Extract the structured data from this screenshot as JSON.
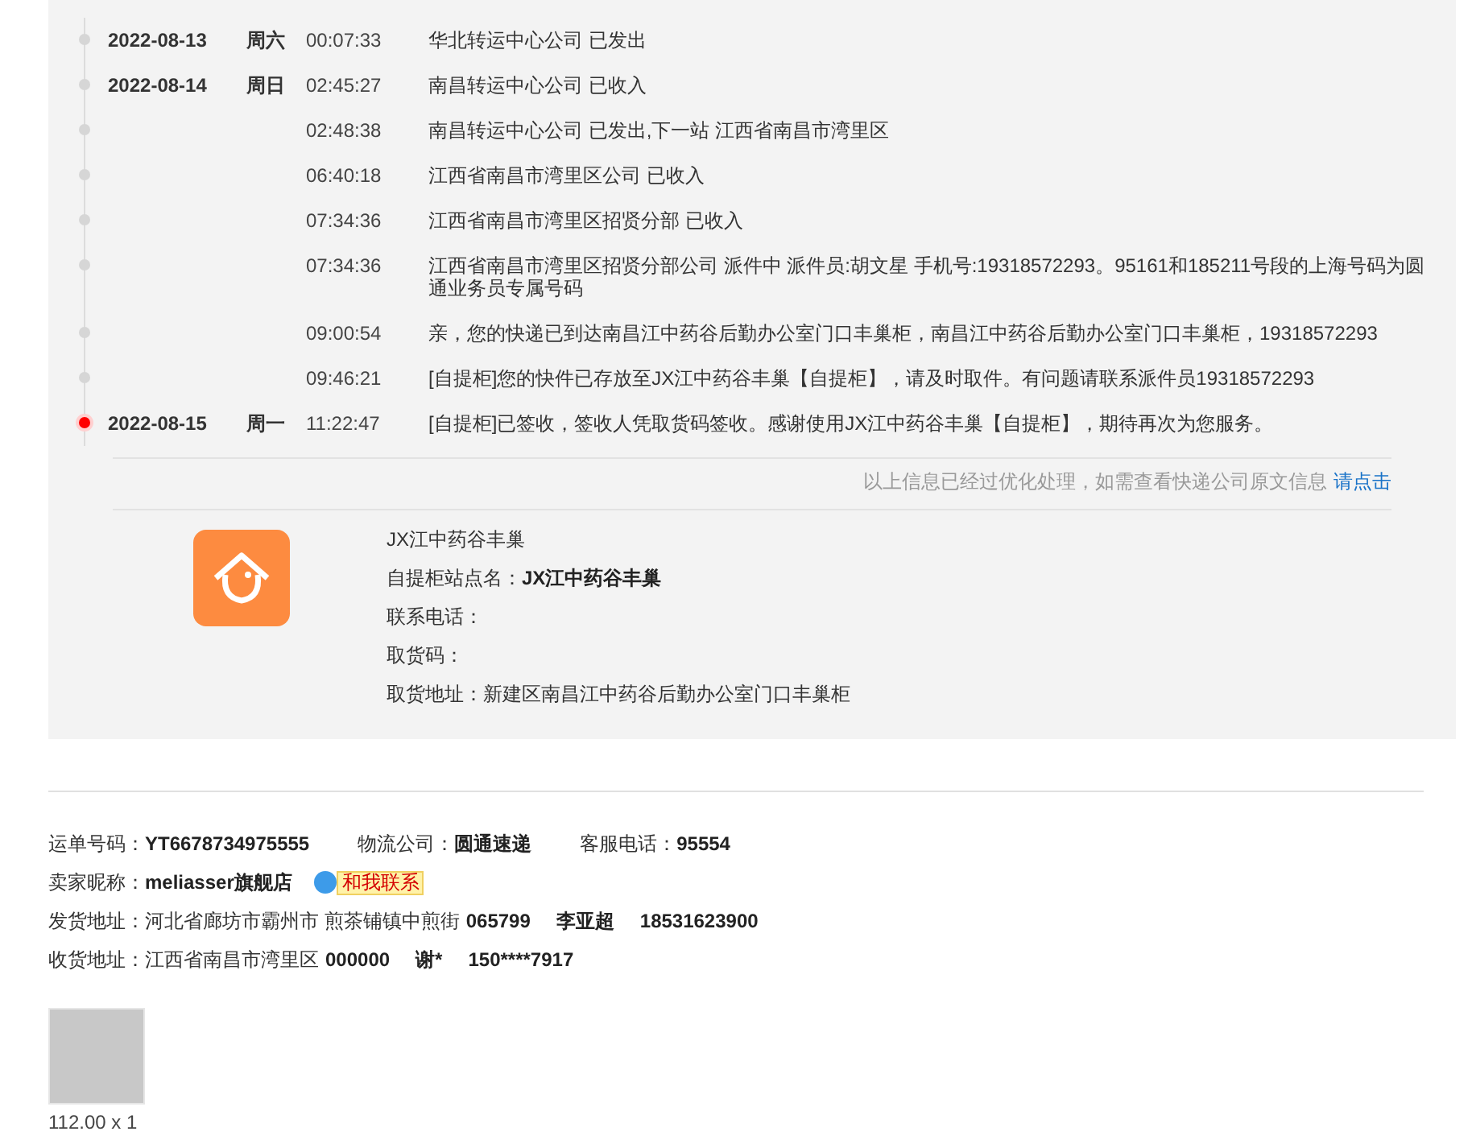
{
  "timeline": [
    {
      "date": "2022-08-13",
      "weekday": "周六",
      "time": "00:07:33",
      "text": "华北转运中心公司 已发出",
      "current": false
    },
    {
      "date": "2022-08-14",
      "weekday": "周日",
      "time": "02:45:27",
      "text": "南昌转运中心公司 已收入",
      "current": false
    },
    {
      "time": "02:48:38",
      "text": "南昌转运中心公司 已发出,下一站 江西省南昌市湾里区",
      "current": false
    },
    {
      "time": "06:40:18",
      "text": "江西省南昌市湾里区公司 已收入",
      "current": false
    },
    {
      "time": "07:34:36",
      "text": "江西省南昌市湾里区招贤分部 已收入",
      "current": false
    },
    {
      "time": "07:34:36",
      "text": "江西省南昌市湾里区招贤分部公司 派件中 派件员:胡文星 手机号:19318572293。95161和185211号段的上海号码为圆通业务员专属号码",
      "current": false
    },
    {
      "time": "09:00:54",
      "text": "亲，您的快递已到达南昌江中药谷后勤办公室门口丰巢柜，南昌江中药谷后勤办公室门口丰巢柜，19318572293",
      "current": false
    },
    {
      "time": "09:46:21",
      "text": "[自提柜]您的快件已存放至JX江中药谷丰巢【自提柜】，请及时取件。有问题请联系派件员19318572293",
      "current": false
    },
    {
      "date": "2022-08-15",
      "weekday": "周一",
      "time": "11:22:47",
      "text": "[自提柜]已签收，签收人凭取货码签收。感谢使用JX江中药谷丰巢【自提柜】，期待再次为您服务。",
      "current": true
    }
  ],
  "note": {
    "text": "以上信息已经过优化处理，如需查看快递公司原文信息",
    "link": "请点击"
  },
  "station": {
    "name": "JX江中药谷丰巢",
    "fields": [
      {
        "label": "自提柜站点名：",
        "value": "JX江中药谷丰巢",
        "kind": "name"
      },
      {
        "label": "联系电话："
      },
      {
        "label": "取货码："
      },
      {
        "label": "取货地址：",
        "value": "新建区南昌江中药谷后勤办公室门口丰巢柜",
        "kind": "address"
      }
    ]
  },
  "info": [
    [
      {
        "label": "运单号码：",
        "value": "YT6678734975555"
      },
      {
        "label": "物流公司：",
        "value": "圆通速递"
      },
      {
        "label": "客服电话：",
        "value": "95554"
      }
    ],
    [
      {
        "label": "卖家昵称：",
        "value": "meliasser旗舰店",
        "contact": "和我联系"
      }
    ],
    [
      {
        "label": "发货地址：",
        "plain": "河北省廊坊市霸州市 煎茶铺镇中煎街",
        "bold": [
          "065799",
          "李亚超",
          "18531623900"
        ]
      }
    ],
    [
      {
        "label": "收货地址：",
        "plain": "江西省南昌市湾里区",
        "bold": [
          "000000",
          "谢*",
          "150****7917"
        ]
      }
    ]
  ],
  "product": {
    "price": "112.00 x 1"
  }
}
